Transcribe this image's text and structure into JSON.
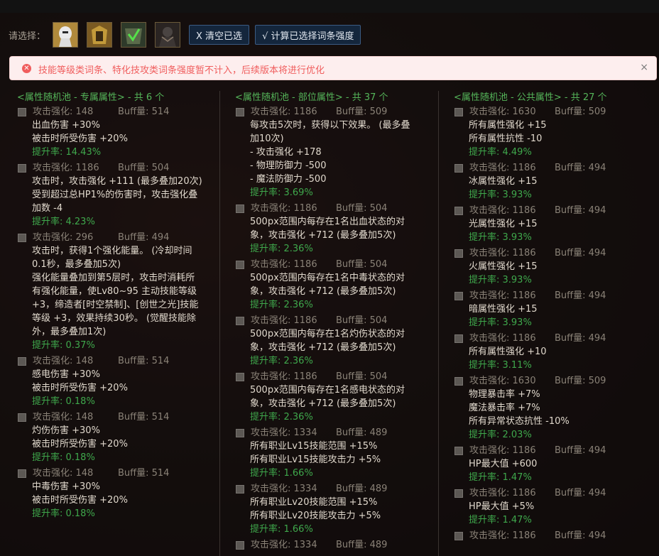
{
  "selector": {
    "label": "请选择：",
    "portraits": [
      {
        "icon": "white-knight-portrait-icon"
      },
      {
        "icon": "gold-armor-portrait-icon"
      },
      {
        "icon": "green-check-portrait-icon"
      },
      {
        "icon": "dark-warrior-portrait-icon"
      }
    ],
    "clear_label": "X 清空已选",
    "calc_label": "√ 计算已选择词条强度"
  },
  "alert": {
    "text": "技能等级类词条、特化技攻类词条强度暂不计入，后续版本将进行优化",
    "close": "×"
  },
  "columns": [
    {
      "header": "<属性随机池 - 专属属性> - 共 6 个",
      "entries": [
        {
          "attack": "攻击强化: 148",
          "buff": "Buff量: 514",
          "lines": [
            "出血伤害 +30%",
            "被击时所受伤害 +20%"
          ],
          "rate": "提升率: 14.43%"
        },
        {
          "attack": "攻击强化: 1186",
          "buff": "Buff量: 504",
          "lines": [
            "攻击时，攻击强化 +111 (最多叠加20次)",
            "受到超过总HP1%的伤害时，攻击强化叠",
            "加数 -4"
          ],
          "rate": "提升率: 4.23%"
        },
        {
          "attack": "攻击强化: 296",
          "buff": "Buff量: 494",
          "lines": [
            "攻击时，获得1个强化能量。 (冷却时间",
            "0.1秒，最多叠加5次)",
            "强化能量叠加到第5层时，攻击时消耗所",
            "有强化能量，使Lv80~95 主动技能等级",
            "+3，缔造者[时空禁制]、[创世之光]技能",
            "等级 +3，效果持续30秒。 (觉醒技能除",
            "外，最多叠加1次)"
          ],
          "rate": "提升率: 0.37%"
        },
        {
          "attack": "攻击强化: 148",
          "buff": "Buff量: 514",
          "lines": [
            "感电伤害 +30%",
            "被击时所受伤害 +20%"
          ],
          "rate": "提升率: 0.18%"
        },
        {
          "attack": "攻击强化: 148",
          "buff": "Buff量: 514",
          "lines": [
            "灼伤伤害 +30%",
            "被击时所受伤害 +20%"
          ],
          "rate": "提升率: 0.18%"
        },
        {
          "attack": "攻击强化: 148",
          "buff": "Buff量: 514",
          "lines": [
            "中毒伤害 +30%",
            "被击时所受伤害 +20%"
          ],
          "rate": "提升率: 0.18%"
        }
      ]
    },
    {
      "header": "<属性随机池 - 部位属性> - 共 37 个",
      "entries": [
        {
          "attack": "攻击强化: 1186",
          "buff": "Buff量: 509",
          "lines": [
            "每攻击5次时，获得以下效果。 (最多叠",
            "加10次)",
            "- 攻击强化 +178",
            "- 物理防御力 -500",
            "- 魔法防御力 -500"
          ],
          "rate": "提升率: 3.69%"
        },
        {
          "attack": "攻击强化: 1186",
          "buff": "Buff量: 504",
          "lines": [
            "500px范围内每存在1名出血状态的对",
            "象，攻击强化 +712 (最多叠加5次)"
          ],
          "rate": "提升率: 2.36%"
        },
        {
          "attack": "攻击强化: 1186",
          "buff": "Buff量: 504",
          "lines": [
            "500px范围内每存在1名中毒状态的对",
            "象，攻击强化 +712 (最多叠加5次)"
          ],
          "rate": "提升率: 2.36%"
        },
        {
          "attack": "攻击强化: 1186",
          "buff": "Buff量: 504",
          "lines": [
            "500px范围内每存在1名灼伤状态的对",
            "象，攻击强化 +712 (最多叠加5次)"
          ],
          "rate": "提升率: 2.36%"
        },
        {
          "attack": "攻击强化: 1186",
          "buff": "Buff量: 504",
          "lines": [
            "500px范围内每存在1名感电状态的对",
            "象，攻击强化 +712 (最多叠加5次)"
          ],
          "rate": "提升率: 2.36%"
        },
        {
          "attack": "攻击强化: 1334",
          "buff": "Buff量: 489",
          "lines": [
            "所有职业Lv15技能范围 +15%",
            "所有职业Lv15技能攻击力 +5%"
          ],
          "rate": "提升率: 1.66%"
        },
        {
          "attack": "攻击强化: 1334",
          "buff": "Buff量: 489",
          "lines": [
            "所有职业Lv20技能范围 +15%",
            "所有职业Lv20技能攻击力 +5%"
          ],
          "rate": "提升率: 1.66%"
        },
        {
          "attack": "攻击强化: 1334",
          "buff": "Buff量: 489",
          "lines": [],
          "rate": ""
        }
      ]
    },
    {
      "header": "<属性随机池 - 公共属性> - 共 27 个",
      "entries": [
        {
          "attack": "攻击强化: 1630",
          "buff": "Buff量: 509",
          "lines": [
            "所有属性强化 +15",
            "所有属性抗性 -10"
          ],
          "rate": "提升率: 4.49%"
        },
        {
          "attack": "攻击强化: 1186",
          "buff": "Buff量: 494",
          "lines": [
            "冰属性强化 +15"
          ],
          "rate": "提升率: 3.93%"
        },
        {
          "attack": "攻击强化: 1186",
          "buff": "Buff量: 494",
          "lines": [
            "光属性强化 +15"
          ],
          "rate": "提升率: 3.93%"
        },
        {
          "attack": "攻击强化: 1186",
          "buff": "Buff量: 494",
          "lines": [
            "火属性强化 +15"
          ],
          "rate": "提升率: 3.93%"
        },
        {
          "attack": "攻击强化: 1186",
          "buff": "Buff量: 494",
          "lines": [
            "暗属性强化 +15"
          ],
          "rate": "提升率: 3.93%"
        },
        {
          "attack": "攻击强化: 1186",
          "buff": "Buff量: 494",
          "lines": [
            "所有属性强化 +10"
          ],
          "rate": "提升率: 3.11%"
        },
        {
          "attack": "攻击强化: 1630",
          "buff": "Buff量: 509",
          "lines": [
            "物理暴击率 +7%",
            "魔法暴击率 +7%",
            "所有异常状态抗性 -10%"
          ],
          "rate": "提升率: 2.03%"
        },
        {
          "attack": "攻击强化: 1186",
          "buff": "Buff量: 494",
          "lines": [
            "HP最大值 +600"
          ],
          "rate": "提升率: 1.47%"
        },
        {
          "attack": "攻击强化: 1186",
          "buff": "Buff量: 494",
          "lines": [
            "HP最大值 +5%"
          ],
          "rate": "提升率: 1.47%"
        },
        {
          "attack": "攻击强化: 1186",
          "buff": "Buff量: 494",
          "lines": [],
          "rate": ""
        }
      ]
    }
  ]
}
